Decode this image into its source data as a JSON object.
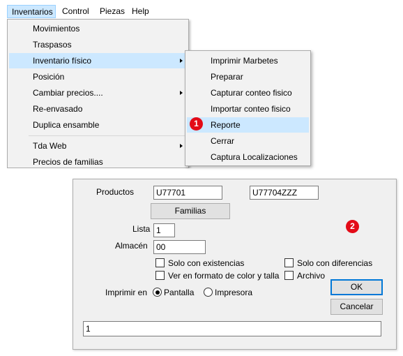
{
  "menubar": {
    "items": [
      "Inventarios",
      "Control",
      "Piezas",
      "Help"
    ]
  },
  "dropdown": {
    "items": [
      {
        "label": "Movimientos"
      },
      {
        "label": "Traspasos"
      },
      {
        "label": "Inventario físico",
        "submenu": true,
        "highlighted": true
      },
      {
        "label": "Posición"
      },
      {
        "label": "Cambiar precios....",
        "submenu": true
      },
      {
        "label": "Re-envasado"
      },
      {
        "label": "Duplica ensamble"
      },
      {
        "label": "Tda Web",
        "submenu": true
      },
      {
        "label": "Precios de familias"
      }
    ]
  },
  "submenu": {
    "items": [
      {
        "label": "Imprimir Marbetes"
      },
      {
        "label": "Preparar"
      },
      {
        "label": "Capturar conteo fisico"
      },
      {
        "label": "Importar conteo fisico"
      },
      {
        "label": "Reporte",
        "highlighted": true
      },
      {
        "label": "Cerrar"
      },
      {
        "label": "Captura Localizaciones"
      }
    ]
  },
  "badges": {
    "one": "1",
    "two": "2",
    "color": "#e30b17"
  },
  "dialog": {
    "productos_label": "Productos",
    "producto_desde": "U77701",
    "producto_hasta": "U77704ZZZ",
    "familias_button": "Familias",
    "lista_label": "Lista",
    "lista_value": "1",
    "almacen_label": "Almacén",
    "almacen_value": "00",
    "checkboxes": {
      "solo_existencias": {
        "label": "Solo con existencias",
        "checked": false
      },
      "solo_diferencias": {
        "label": "Solo con diferencias",
        "checked": false
      },
      "formato_color": {
        "label": "Ver en formato de color y talla",
        "checked": false
      },
      "archivo": {
        "label": "Archivo",
        "checked": false
      }
    },
    "imprimir_label": "Imprimir en",
    "radios": {
      "pantalla": {
        "label": "Pantalla",
        "selected": true
      },
      "impresora": {
        "label": "Impresora",
        "selected": false
      }
    },
    "ok_button": "OK",
    "cancel_button": "Cancelar",
    "bottom_field": "1"
  },
  "colors": {
    "highlight": "#cce8ff",
    "menu_bg": "#f2f2f2",
    "dialog_bg": "#f0f0f0",
    "default_border": "#0078d7"
  }
}
